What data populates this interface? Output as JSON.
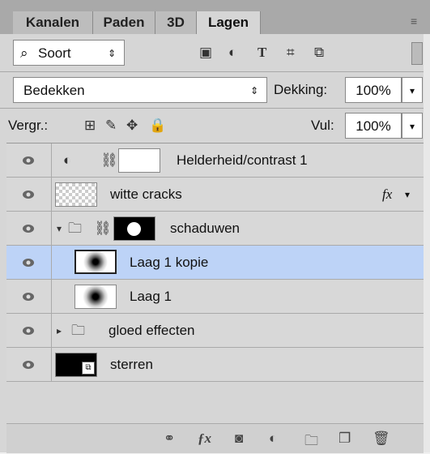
{
  "tabs": [
    "Kanalen",
    "Paden",
    "3D",
    "Lagen"
  ],
  "filter": {
    "label": "Soort",
    "icons": [
      "image-filter-icon",
      "adjustment-filter-icon",
      "text-filter-icon",
      "shape-filter-icon",
      "smart-object-filter-icon"
    ]
  },
  "blend": {
    "mode": "Bedekken",
    "opacity_label": "Dekking:",
    "opacity_value": "100%"
  },
  "lock": {
    "label": "Vergr.:",
    "fill_label": "Vul:",
    "fill_value": "100%"
  },
  "layers": [
    {
      "name": "Helderheid/contrast 1",
      "type": "adjustment"
    },
    {
      "name": "witte cracks",
      "type": "pixel",
      "fx": "fx"
    },
    {
      "name": "schaduwen",
      "type": "group"
    },
    {
      "name": "Laag 1 kopie",
      "type": "pixel",
      "selected": true
    },
    {
      "name": "Laag 1",
      "type": "pixel"
    },
    {
      "name": "gloed effecten",
      "type": "group"
    },
    {
      "name": "sterren",
      "type": "smart-object"
    }
  ],
  "colors": {
    "selected": "#bdd3f7",
    "panel": "#d6d6d6",
    "tabbar": "#a9a9a9"
  }
}
